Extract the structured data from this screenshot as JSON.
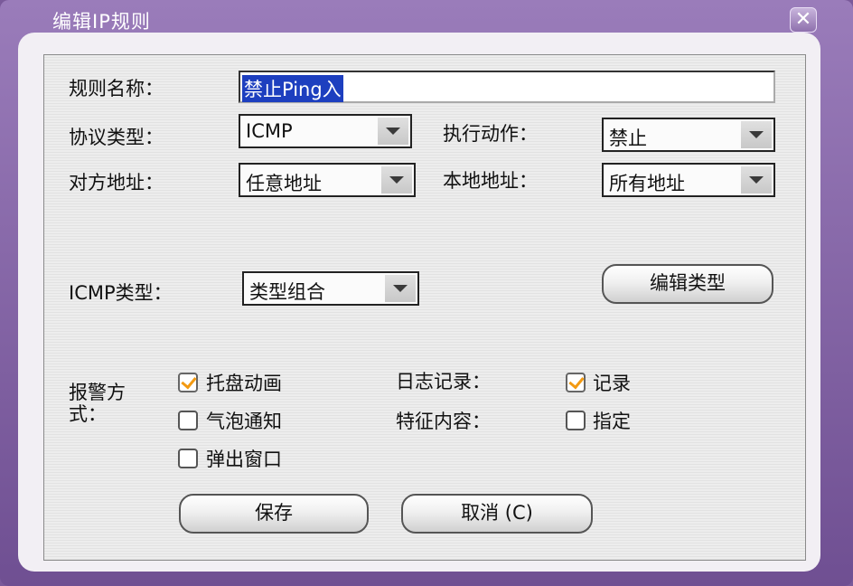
{
  "window": {
    "title": "编辑IP规则",
    "close_glyph": "✕"
  },
  "form": {
    "rule_name_label": "规则名称：",
    "rule_name_value": "禁止Ping入",
    "protocol_label": "协议类型：",
    "protocol_value": "ICMP",
    "action_label": "执行动作：",
    "action_value": "禁止",
    "remote_addr_label": "对方地址：",
    "remote_addr_value": "任意地址",
    "local_addr_label": "本地地址：",
    "local_addr_value": "所有地址",
    "icmp_type_label": "ICMP类型：",
    "icmp_type_value": "类型组合",
    "edit_type_button": "编辑类型",
    "alert_label_line1": "报警方",
    "alert_label_line2": "式：",
    "alert_options": [
      {
        "label": "托盘动画",
        "checked": true
      },
      {
        "label": "气泡通知",
        "checked": false
      },
      {
        "label": "弹出窗口",
        "checked": false
      }
    ],
    "log_label": "日志记录：",
    "log_option": {
      "label": "记录",
      "checked": true
    },
    "feature_label": "特征内容：",
    "feature_option": {
      "label": "指定",
      "checked": false
    },
    "save_button": "保存",
    "cancel_button": "取消 (C)"
  },
  "colors": {
    "check_mark": "#f39a12",
    "selection": "#1d3fbf",
    "frame": "#7a5a9a"
  }
}
